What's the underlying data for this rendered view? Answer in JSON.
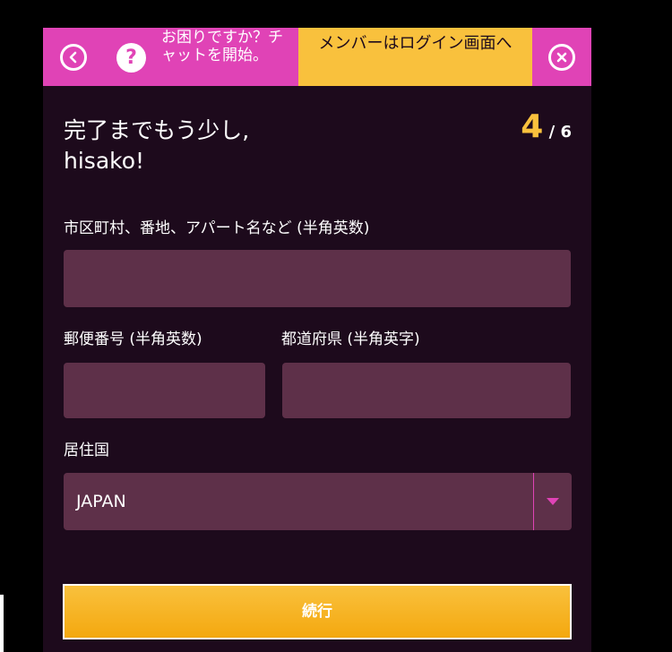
{
  "topbar": {
    "back_icon": "chevron-left-icon",
    "help_icon": "question-icon",
    "help_glyph": "?",
    "help_text": "お困りですか？チャットを開始。",
    "login_text": "メンバーはログイン画面へ",
    "close_icon": "close-icon"
  },
  "form": {
    "title_line1": "完了までもう少し,",
    "title_line2": "hisako!",
    "step_current": "4",
    "step_total": " / 6",
    "address_label": "市区町村、番地、アパート名など (半角英数)",
    "address_value": "",
    "postal_label": "郵便番号 (半角英数)",
    "postal_value": "",
    "prefecture_label": "都道府県 (半角英字)",
    "prefecture_value": "",
    "country_label": "居住国",
    "country_value": "JAPAN",
    "continue_label": "続行"
  },
  "colors": {
    "accent_pink": "#e043b6",
    "accent_yellow": "#f9c13d",
    "background": "#1d0a1c",
    "field": "#5e3049"
  }
}
